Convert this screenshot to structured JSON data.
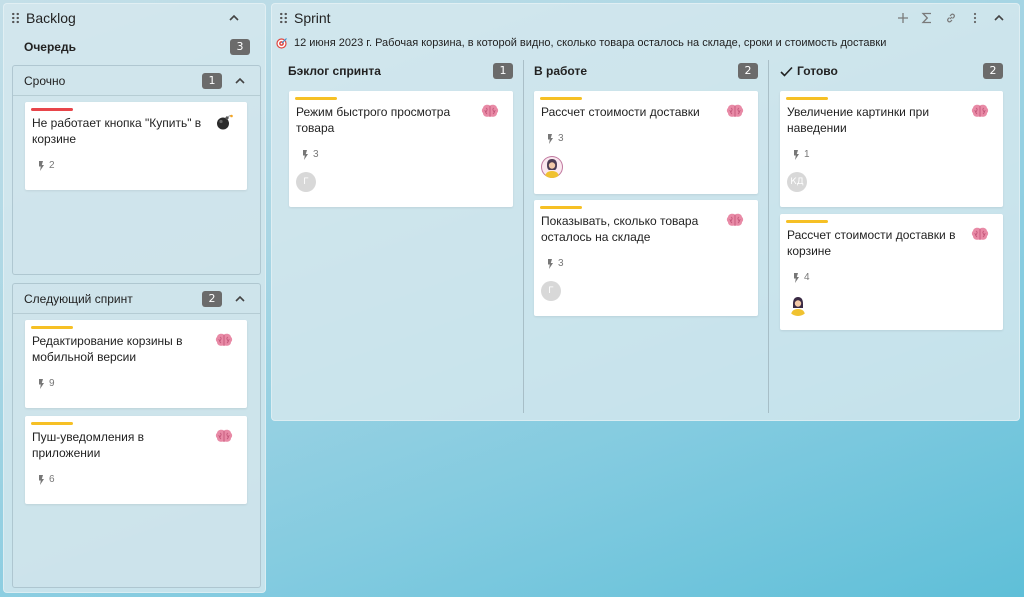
{
  "backlog": {
    "title": "Backlog",
    "queue_label": "Очередь",
    "queue_count": "3",
    "groups": [
      {
        "title": "Срочно",
        "count": "1",
        "cards": [
          {
            "title": "Не работает кнопка \"Купить\" в корзине",
            "points": "2",
            "stripe": "red",
            "icon": "bomb-icon"
          }
        ]
      },
      {
        "title": "Следующий спринт",
        "count": "2",
        "cards": [
          {
            "title": "Редактирование корзины в мобильной версии",
            "points": "9",
            "stripe": "yellow",
            "icon": "brain-icon"
          },
          {
            "title": "Пуш-уведомления в приложении",
            "points": "6",
            "stripe": "yellow",
            "icon": "brain-icon"
          }
        ]
      }
    ]
  },
  "sprint": {
    "title": "Sprint",
    "subtitle": "12 июня 2023 г. Рабочая корзина, в которой видно, сколько товара осталось на складе, сроки и стоимость доставки",
    "tools": [
      "plus-icon",
      "sigma-icon",
      "link-icon",
      "more-icon",
      "chevron-up-icon"
    ],
    "columns": [
      {
        "title": "Бэклог спринта",
        "count": "1",
        "cards": [
          {
            "title": "Режим быстрого просмотра товара",
            "points": "3",
            "avatar": "Г",
            "icon": "brain-icon"
          }
        ]
      },
      {
        "title": "В работе",
        "count": "2",
        "cards": [
          {
            "title": "Рассчет стоимости доставки",
            "points": "3",
            "avatar": "photo",
            "icon": "brain-icon"
          },
          {
            "title": "Показывать, сколько товара осталось на складе",
            "points": "3",
            "avatar": "Г",
            "icon": "brain-icon"
          }
        ]
      },
      {
        "title": "Готово",
        "count": "2",
        "cards": [
          {
            "title": "Увеличение картинки при наведении",
            "points": "1",
            "avatar": "КД",
            "icon": "brain-icon"
          },
          {
            "title": "Рассчет стоимости доставки в корзине",
            "points": "4",
            "avatar": "photo",
            "icon": "brain-icon"
          }
        ]
      }
    ]
  },
  "colors": {
    "stripe_red": "#e8454a",
    "stripe_yellow": "#f6c025",
    "badge": "#6b6b6b",
    "brain": "#e88aa6"
  }
}
